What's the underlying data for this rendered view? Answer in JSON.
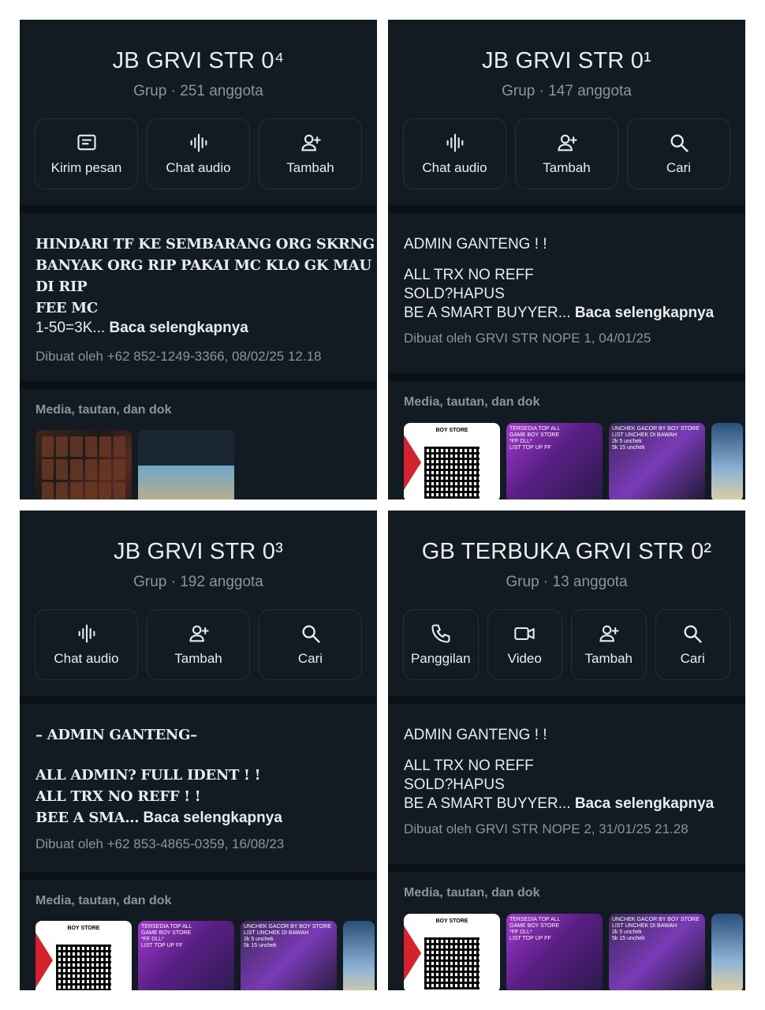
{
  "panels": [
    {
      "title": "JB GRVI STR 0⁴",
      "subtitle": "Grup · 251 anggota",
      "actions": [
        {
          "icon": "message-icon",
          "label": "Kirim pesan"
        },
        {
          "icon": "audio-wave-icon",
          "label": "Chat audio"
        },
        {
          "icon": "add-person-icon",
          "label": "Tambah"
        }
      ],
      "description": {
        "lines": [
          "HINDARI TF KE SEMBARANG ORG SKRNG",
          "BANYAK ORG RIP PAKAI MC KLO GK MAU",
          "DI RIP",
          "FEE MC"
        ],
        "last": "1-50=3K...",
        "more": "Baca selengkapnya",
        "created": "Dibuat oleh +62 852-1249-3366, 08/02/25 12.18"
      },
      "media_title": "Media, tautan, dan dok"
    },
    {
      "title": "JB GRVI STR 0¹",
      "subtitle": "Grup · 147 anggota",
      "actions": [
        {
          "icon": "audio-wave-icon",
          "label": "Chat audio"
        },
        {
          "icon": "add-person-icon",
          "label": "Tambah"
        },
        {
          "icon": "search-icon",
          "label": "Cari"
        }
      ],
      "description": {
        "lines": [
          "ADMIN GANTENG ! !",
          "",
          "ALL TRX NO REFF",
          "SOLD?HAPUS"
        ],
        "last": "BE A SMART BUYYER...",
        "more": "Baca selengkapnya",
        "created": "Dibuat oleh GRVI STR NOPE 1, 04/01/25"
      },
      "media_title": "Media, tautan, dan dok",
      "thumb_texts": {
        "qr": "BOY STORE",
        "purple1": "TERSEDIA TOP ALL\nGAME BOY STORE\n*FF DLL*\nLIST TOP UP FF",
        "purple2": "UNCHEK GACOR BY BOY STORE\nLIST UNCHEK DI BAWAH\n2k 5 unchek\n5k 15 unchek"
      }
    },
    {
      "title": "JB GRVI STR 0³",
      "subtitle": "Grup · 192 anggota",
      "actions": [
        {
          "icon": "audio-wave-icon",
          "label": "Chat audio"
        },
        {
          "icon": "add-person-icon",
          "label": "Tambah"
        },
        {
          "icon": "search-icon",
          "label": "Cari"
        }
      ],
      "description": {
        "lines": [
          "– ADMIN GANTENG–",
          "",
          "ALL ADMIN? FULL IDENT ! !",
          "ALL TRX NO REFF ! !"
        ],
        "last": "BEE A SMA...",
        "more": "Baca selengkapnya",
        "created": "Dibuat oleh +62 853-4865-0359, 16/08/23"
      },
      "media_title": "Media, tautan, dan dok",
      "thumb_texts": {
        "qr": "BOY STORE",
        "purple1": "TERSEDIA TOP ALL\nGAME BOY STORE\n*FF DLL*\nLIST TOP UP FF",
        "purple2": "UNCHEK GACOR BY BOY STORE\nLIST UNCHEK DI BAWAH\n2k 5 unchek\n5k 15 unchek"
      }
    },
    {
      "title": "GB TERBUKA GRVI STR 0²",
      "subtitle": "Grup · 13 anggota",
      "actions": [
        {
          "icon": "phone-icon",
          "label": "Panggilan"
        },
        {
          "icon": "video-icon",
          "label": "Video"
        },
        {
          "icon": "add-person-icon",
          "label": "Tambah"
        },
        {
          "icon": "search-icon",
          "label": "Cari"
        }
      ],
      "description": {
        "lines": [
          "ADMIN GANTENG ! !",
          "",
          "ALL TRX NO REFF",
          "SOLD?HAPUS"
        ],
        "last": "BE A SMART BUYYER...",
        "more": "Baca selengkapnya",
        "created": "Dibuat oleh GRVI STR NOPE 2, 31/01/25 21.28"
      },
      "media_title": "Media, tautan, dan dok",
      "thumb_texts": {
        "qr": "BOY STORE",
        "purple1": "TERSEDIA TOP ALL\nGAME BOY STORE\n*FF DLL*\nLIST TOP UP FF",
        "purple2": "UNCHEK GACOR BY BOY STORE\nLIST UNCHEK DI BAWAH\n2k 5 unchek\n5k 15 unchek"
      }
    }
  ],
  "colors": {
    "background": "#0b1014",
    "card": "#111b21",
    "text": "#e9edef",
    "muted": "#8696a0",
    "border": "#233138"
  }
}
